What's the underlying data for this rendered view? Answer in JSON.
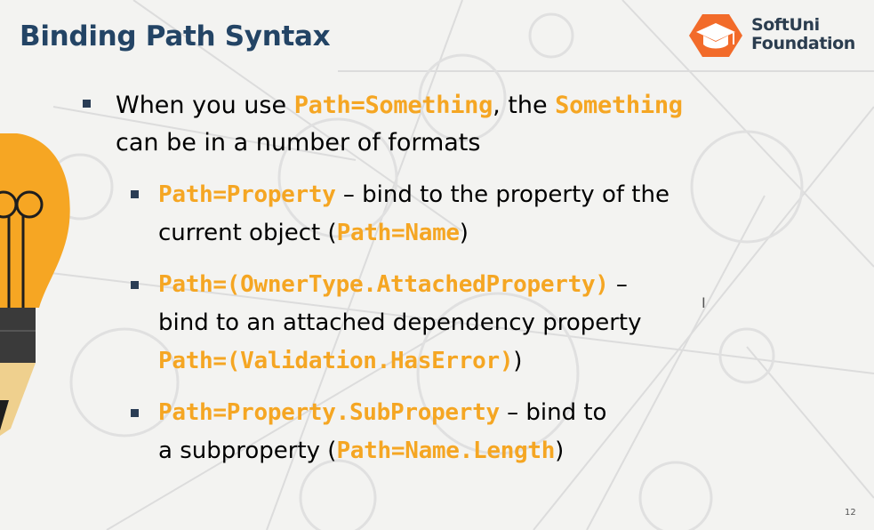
{
  "title": "Binding Path Syntax",
  "logo": {
    "line1": "SoftUni",
    "line2": "Foundation",
    "icon": "graduation-cap-hexagon-icon",
    "color": "#f26b2a"
  },
  "colors": {
    "title": "#234465",
    "code": "#f5a623",
    "text": "#2a2a2a",
    "bullet": "#2a3d55"
  },
  "main_bullet": {
    "text1": "When you use ",
    "code1": "Path=Something",
    "text2": ", the ",
    "code2": "Something",
    "text3": "can be in a number of formats"
  },
  "sub_bullets": [
    {
      "code": "Path=Property",
      "text1": " – bind to the property of the",
      "text2": "current object ",
      "open": "(",
      "example": "Path=Name",
      "close": ")"
    },
    {
      "code": "Path=(OwnerType.AttachedProperty)",
      "dash": " –",
      "text2": "bind to an attached dependency property",
      "example": "Path=(Validation.HasError)",
      "close": ")"
    },
    {
      "code": "Path=Property.SubProperty",
      "text1": " – bind to",
      "text2": "a subproperty ",
      "open": "(",
      "example": "Path=Name.Length",
      "close": ")"
    }
  ],
  "cursor_glyph": "I",
  "slide_number": "12"
}
